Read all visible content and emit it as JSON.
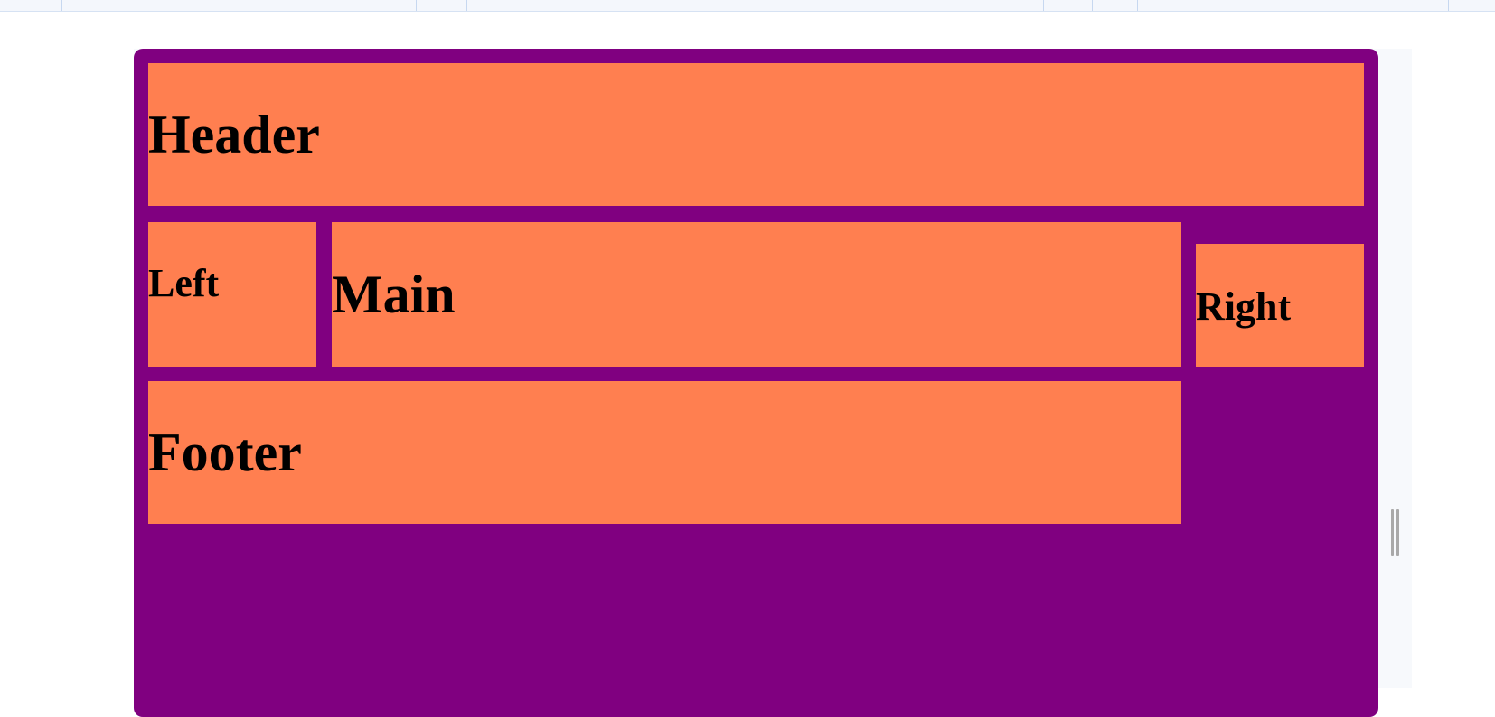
{
  "layout_demo": {
    "header": "Header",
    "left": "Left",
    "main": "Main",
    "right": "Right",
    "footer": "Footer"
  },
  "colors": {
    "container": "#800080",
    "cell": "#ff7f50",
    "text": "#000000"
  },
  "icons": {
    "resize_handle": "vertical-resize-grip-icon"
  }
}
